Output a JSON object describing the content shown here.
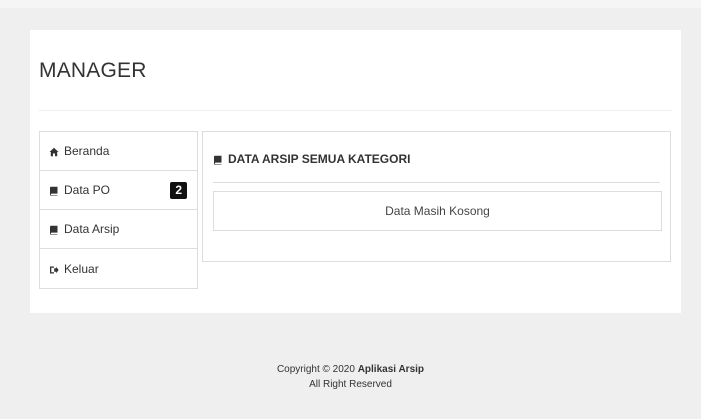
{
  "app": {
    "title": "MANAGER"
  },
  "sidebar": {
    "items": [
      {
        "label": "Beranda",
        "icon": "home-icon"
      },
      {
        "label": "Data PO",
        "icon": "book-icon",
        "badge": "2"
      },
      {
        "label": "Data Arsip",
        "icon": "book-icon"
      },
      {
        "label": "Keluar",
        "icon": "sign-out-icon"
      }
    ]
  },
  "panel": {
    "heading": "DATA ARSIP SEMUA KATEGORI",
    "heading_icon": "book-icon",
    "empty_message": "Data Masih Kosong"
  },
  "footer": {
    "copyright_prefix": "Copyright © 2020",
    "app_name": "Aplikasi Arsip",
    "rights": "All Right Reserved"
  },
  "colors": {
    "background": "#efefef",
    "card": "#ffffff",
    "border": "#dddddd",
    "badge": "#111111",
    "text": "#333333"
  }
}
